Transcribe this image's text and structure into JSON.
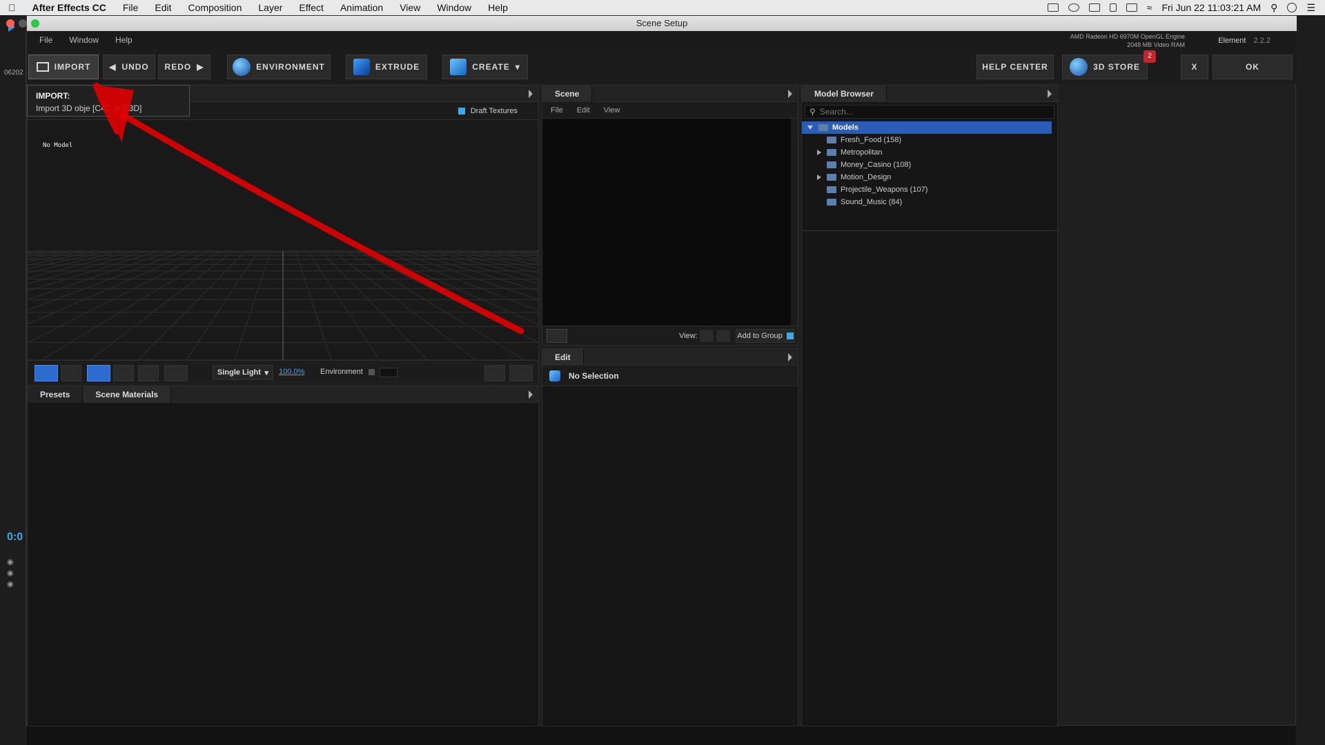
{
  "mac_menubar": {
    "app": "After Effects CC",
    "items": [
      "File",
      "Edit",
      "Composition",
      "Layer",
      "Effect",
      "Animation",
      "View",
      "Window",
      "Help"
    ],
    "clock": "Fri Jun 22  11:03:21 AM"
  },
  "window": {
    "title": "Scene Setup",
    "menu": [
      "File",
      "Window",
      "Help"
    ],
    "gpu_line1": "AMD Radeon HD 6970M OpenGL Engine",
    "gpu_line2": "2048 MB Video RAM",
    "element_label": "Element",
    "element_version": "2.2.2"
  },
  "toolbar": {
    "import": "IMPORT",
    "undo": "UNDO",
    "redo": "REDO",
    "environment": "ENVIRONMENT",
    "extrude": "EXTRUDE",
    "create": "CREATE",
    "help_center": "HELP CENTER",
    "store": "3D STORE",
    "store_badge": "2",
    "close": "X",
    "ok": "OK"
  },
  "tooltip": {
    "title": "IMPORT:",
    "text": "Import 3D obje      [C4D or E3D]"
  },
  "viewport": {
    "draft_textures": "Draft Textures",
    "no_model": "No Model",
    "light_mode": "Single Light",
    "zoom": "100.0%",
    "environment_label": "Environment"
  },
  "presets": {
    "tabs": [
      "Presets",
      "Scene Materials"
    ]
  },
  "scene": {
    "title": "Scene",
    "menu": [
      "File",
      "Edit",
      "View"
    ],
    "view_label": "View:",
    "add_to_group": "Add to Group"
  },
  "edit": {
    "title": "Edit",
    "selection": "No Selection"
  },
  "browser": {
    "title": "Model Browser",
    "search_placeholder": "Search...",
    "root": "Models",
    "folders": [
      {
        "name": "Fresh_Food (158)",
        "expandable": false
      },
      {
        "name": "Metropolitan",
        "expandable": true
      },
      {
        "name": "Money_Casino (108)",
        "expandable": false
      },
      {
        "name": "Motion_Design",
        "expandable": true
      },
      {
        "name": "Projectile_Weapons (107)",
        "expandable": false
      },
      {
        "name": "Sound_Music (84)",
        "expandable": false
      }
    ]
  },
  "ae_left": {
    "code": "06202",
    "time": "0:0"
  },
  "colors": {
    "accent": "#3fa9e8",
    "selection": "#2a5cb8",
    "annotation": "#e00000",
    "badge": "#c0272d"
  }
}
